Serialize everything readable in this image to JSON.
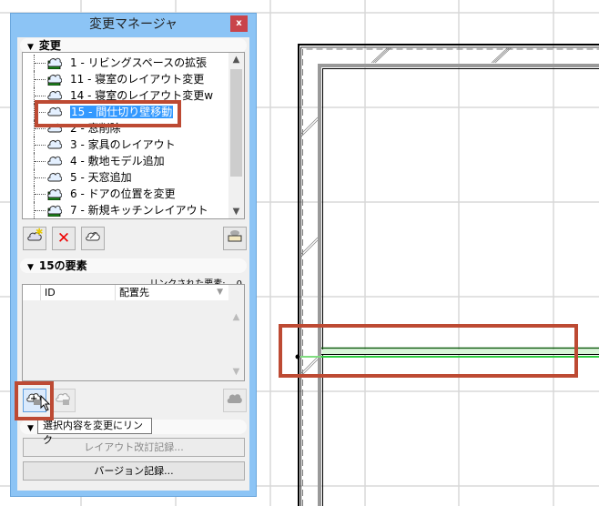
{
  "panel": {
    "title": "変更マネージャ",
    "close_label": "x",
    "changes_section": {
      "header": "変更",
      "items": [
        {
          "label": "1 - リビングスペースの拡張",
          "icon": "linked-change-icon",
          "selected": false
        },
        {
          "label": "11 - 寝室のレイアウト変更",
          "icon": "linked-change-icon",
          "selected": false
        },
        {
          "label": "14 - 寝室のレイアウト変更w",
          "icon": "change-cloud-icon",
          "selected": false
        },
        {
          "label": "15 - 間仕切り壁移動",
          "icon": "change-cloud-icon",
          "selected": true
        },
        {
          "label": "2 - 窓削除",
          "icon": "change-cloud-icon",
          "selected": false
        },
        {
          "label": "3 - 家具のレイアウト",
          "icon": "change-cloud-icon",
          "selected": false
        },
        {
          "label": "4 - 敷地モデル追加",
          "icon": "change-cloud-icon",
          "selected": false
        },
        {
          "label": "5 - 天窓追加",
          "icon": "change-cloud-icon",
          "selected": false
        },
        {
          "label": "6 - ドアの位置を変更",
          "icon": "linked-change-icon",
          "selected": false
        },
        {
          "label": "7 - 新規キッチンレイアウト",
          "icon": "linked-change-icon",
          "selected": false
        }
      ]
    },
    "elements_section": {
      "header": "15の要素",
      "linked_label": "リンクされた要素:",
      "linked_count": "0",
      "columns": [
        "ID",
        "配置先"
      ]
    },
    "tooltip": "選択内容を変更にリンク",
    "layout_revision_button": "レイアウト改訂記録...",
    "version_button": "バージョン記録..."
  },
  "colors": {
    "highlight": "#bd4a33",
    "selection": "#3399ff",
    "wall_green": "#2ecc40"
  }
}
